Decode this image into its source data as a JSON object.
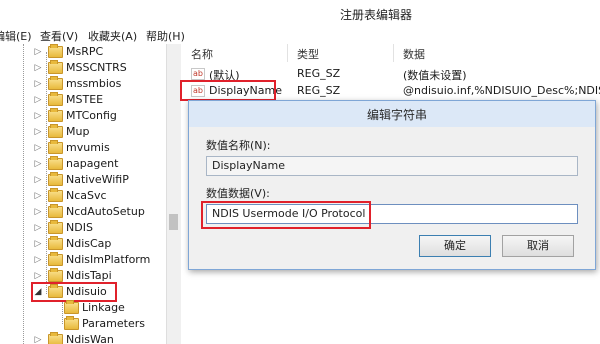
{
  "window": {
    "title": "注册表编辑器"
  },
  "menu": [
    "编辑(E)",
    "查看(V)",
    "收藏夹(A)",
    "帮助(H)"
  ],
  "tree": {
    "items": [
      {
        "label": "MsRPC",
        "expanded": false
      },
      {
        "label": "MSSCNTRS",
        "expanded": false
      },
      {
        "label": "mssmbios",
        "expanded": false
      },
      {
        "label": "MSTEE",
        "expanded": false
      },
      {
        "label": "MTConfig",
        "expanded": false
      },
      {
        "label": "Mup",
        "expanded": false
      },
      {
        "label": "mvumis",
        "expanded": false
      },
      {
        "label": "napagent",
        "expanded": false
      },
      {
        "label": "NativeWifiP",
        "expanded": false
      },
      {
        "label": "NcaSvc",
        "expanded": false
      },
      {
        "label": "NcdAutoSetup",
        "expanded": false
      },
      {
        "label": "NDIS",
        "expanded": false
      },
      {
        "label": "NdisCap",
        "expanded": false
      },
      {
        "label": "NdisImPlatform",
        "expanded": false
      },
      {
        "label": "NdisTapi",
        "expanded": false
      },
      {
        "label": "Ndisuio",
        "expanded": true,
        "selected": true
      },
      {
        "label": "Linkage",
        "child": true
      },
      {
        "label": "Parameters",
        "child": true
      },
      {
        "label": "NdisWan",
        "expanded": false
      }
    ]
  },
  "list": {
    "headers": {
      "name": "名称",
      "type": "类型",
      "data": "数据"
    },
    "rows": [
      {
        "name": "(默认)",
        "type": "REG_SZ",
        "data": "(数值未设置)"
      },
      {
        "name": "DisplayName",
        "type": "REG_SZ",
        "data": "@ndisuio.inf,%NDISUIO_Desc%;NDIS U"
      }
    ]
  },
  "dialog": {
    "title": "编辑字符串",
    "value_name_label": "数值名称(N):",
    "value_name": "DisplayName",
    "value_data_label": "数值数据(V):",
    "value_data": "NDIS Usermode I/O Protocol",
    "ok_label": "确定",
    "cancel_label": "取消"
  },
  "colors": {
    "highlight": "#e0212b",
    "dialog_border": "#7fa6d6"
  }
}
